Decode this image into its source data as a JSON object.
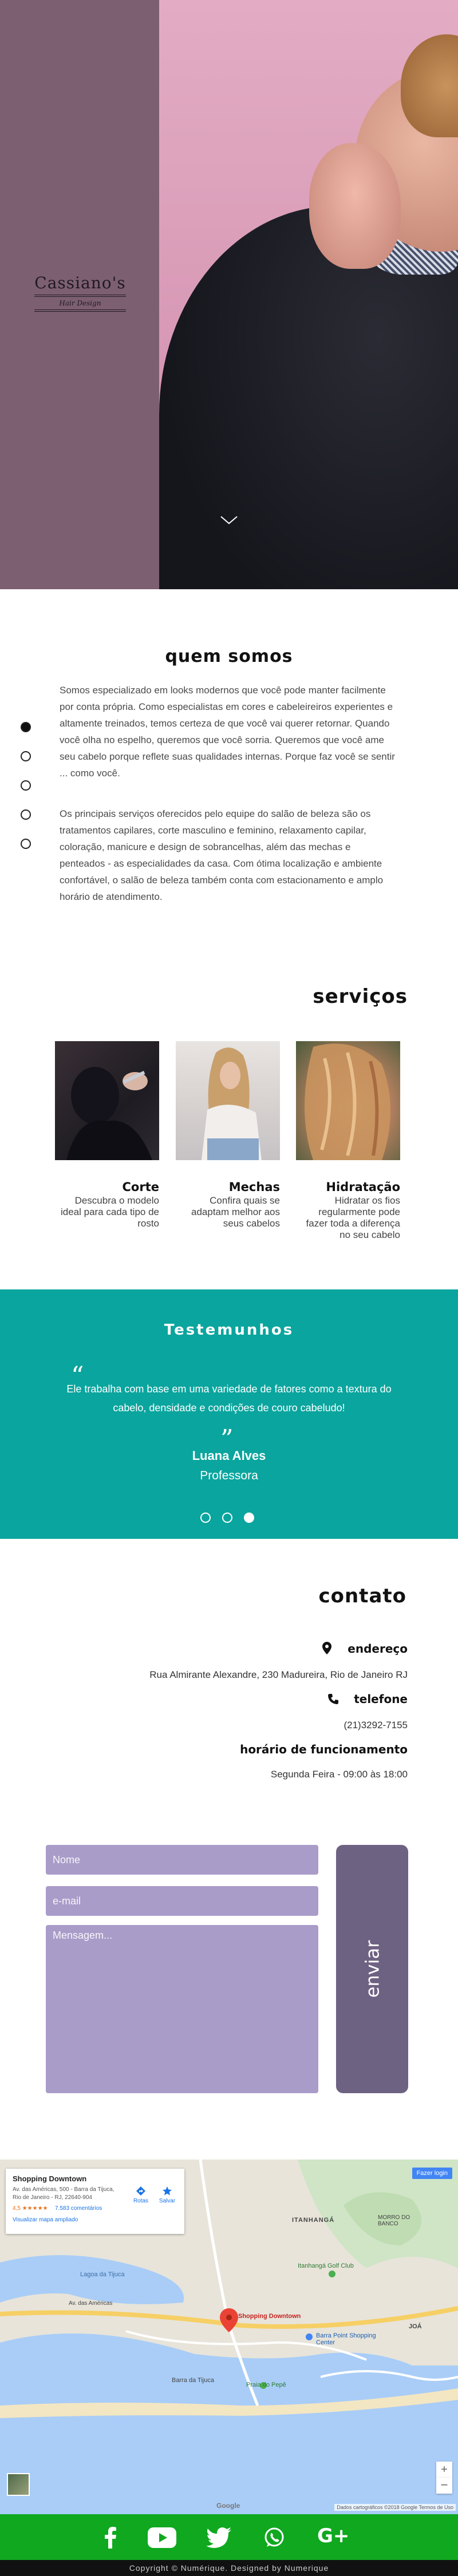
{
  "hero": {
    "logo_name": "Cassiano's",
    "logo_sub": "Hair Design"
  },
  "about": {
    "title": "quem somos",
    "p1": "Somos especializado em looks modernos que você pode manter facilmente por conta própria. Como especialistas em cores e cabeleireiros experientes e altamente treinados, temos certeza de que você vai querer retornar. Quando você olha no espelho, queremos que você sorria. Queremos que você ame seu cabelo porque reflete suas qualidades internas. Porque faz você se sentir ... como você.",
    "p2": "Os principais serviços oferecidos pelo equipe do salão de beleza são os tratamentos capilares, corte masculino e feminino, relaxamento capilar, coloração, manicure e design de sobrancelhas, além das mechas e penteados - as especialidades da casa. Com ótima localização e ambiente confortável, o salão de beleza também conta com estacionamento e amplo horário de atendimento."
  },
  "dot_nav": {
    "count": 5,
    "active_index": 0
  },
  "services": {
    "title": "serviços",
    "items": [
      {
        "name": "Corte",
        "desc": "Descubra o modelo ideal para cada tipo de rosto"
      },
      {
        "name": "Mechas",
        "desc": "Confira quais se adaptam melhor aos seus cabelos"
      },
      {
        "name": "Hidratação",
        "desc": "Hidratar os fios regularmente pode fazer toda a diferença no seu cabelo"
      }
    ]
  },
  "testimonials": {
    "title": "Testemunhos",
    "quote_open": "“",
    "quote_close": "”",
    "text": "Ele trabalha com base em uma variedade de fatores como a textura do cabelo, densidade e condições de couro cabeludo!",
    "author": "Luana Alves",
    "role": "Professora",
    "slides": 3,
    "active_slide": 2
  },
  "contact": {
    "title": "contato",
    "address_label": "endereço",
    "address": "Rua Almirante Alexandre, 230 Madureira, Rio de Janeiro RJ",
    "phone_label": "telefone",
    "phone": "(21)3292-7155",
    "hours_label": "horário de funcionamento",
    "hours": "Segunda Feira - 09:00 às 18:00"
  },
  "form": {
    "name_placeholder": "Nome",
    "email_placeholder": "e-mail",
    "message_placeholder": "Mensagem...",
    "send_label": "enviar"
  },
  "map": {
    "place_name": "Shopping Downtown",
    "place_address": "Av. das Américas, 500 - Barra da Tijuca, Rio de Janeiro - RJ, 22640-904",
    "rating": "4,5 ★★★★★",
    "reviews": "7.583 comentários",
    "bigger_map": "Visualizar mapa ampliado",
    "routes": "Rotas",
    "save": "Salvar",
    "open_app": "Fazer login",
    "labels": {
      "itanhanga": "ITANHANGÁ",
      "morro_banco": "MORRO DO BANCO",
      "lagoa_tijuca": "Lagoa da Tijuca",
      "itanhanga_golf": "Itanhangá Golf Club",
      "marker": "Shopping Downtown",
      "barra_point": "Barra Point Shopping Center",
      "praia_pepe": "Praia do Pepê",
      "barra_tijuca": "Barra da Tijuca",
      "av_americas": "Av. das Américas",
      "joa": "JOÁ"
    },
    "zoom_in": "+",
    "zoom_out": "−",
    "google": "Google",
    "terms": "Dados cartográficos ©2018 Google   Termos de Uso"
  },
  "social": {
    "icons": [
      "facebook-icon",
      "youtube-icon",
      "twitter-icon",
      "whatsapp-icon",
      "google-plus-icon"
    ],
    "google_plus_text": "G+"
  },
  "footer": {
    "text": "Copyright © Numérique. Designed by Numerique"
  },
  "colors": {
    "hero_left": "#7d5f72",
    "hero_pink": "#e3acc4",
    "teal": "#0aa59e",
    "field": "#a99cc9",
    "send": "#6e6283",
    "social": "#0fa81f",
    "footer": "#111111"
  }
}
